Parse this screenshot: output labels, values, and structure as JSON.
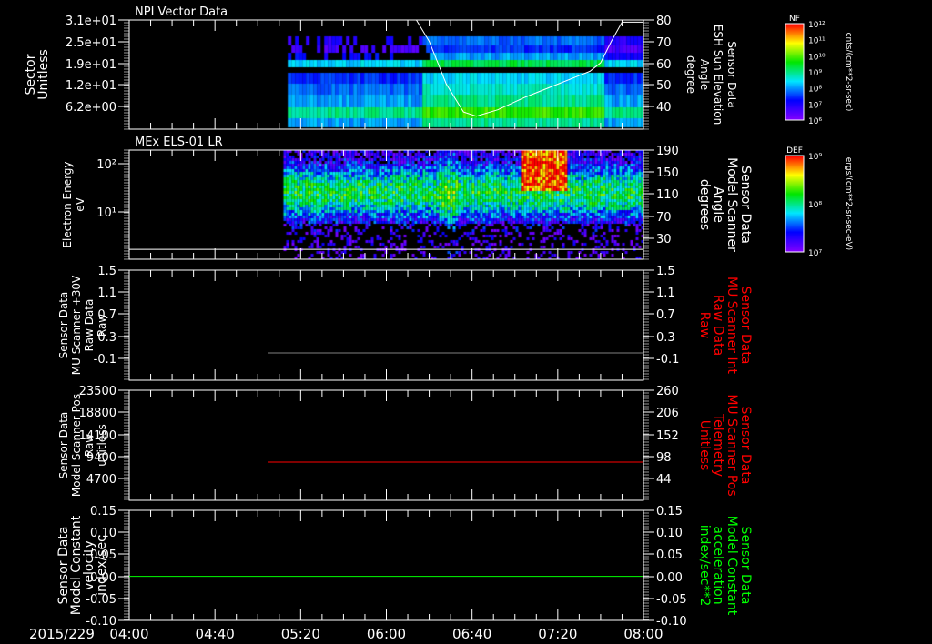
{
  "chart_data": {
    "type": "heatmap",
    "time_axis": {
      "date_label": "2015/229",
      "ticks": [
        "04:00",
        "04:40",
        "05:20",
        "06:00",
        "06:40",
        "07:20",
        "08:00"
      ],
      "range": [
        "04:00",
        "08:00"
      ]
    },
    "panels": [
      {
        "title": "NPI Vector Data",
        "left_label": [
          "Sector",
          "Unitless"
        ],
        "left_ticks": [
          "3.1e+01",
          "2.5e+01",
          "1.9e+01",
          "1.2e+01",
          "6.2e+00"
        ],
        "right_label": [
          "Sensor Data",
          "ESH Sun Elevation",
          "Angle",
          "degree"
        ],
        "right_label_color": "#ffffff",
        "right_ticks": [
          "80",
          "70",
          "60",
          "50",
          "40"
        ],
        "right_range": [
          29,
          80
        ],
        "spectrogram_start": "05:14",
        "line": {
          "color": "#ffffff",
          "x": [
            "06:14",
            "06:20",
            "06:28",
            "06:36",
            "06:42",
            "06:52",
            "07:05",
            "07:20",
            "07:35",
            "07:40",
            "07:45",
            "07:50",
            "08:00"
          ],
          "y": [
            80,
            70,
            50,
            37,
            35,
            38,
            44,
            50,
            56,
            60,
            70,
            79,
            79
          ]
        },
        "colorbar": {
          "label": "NF",
          "ticks": [
            "10¹²",
            "10¹¹",
            "10¹⁰",
            "10⁹",
            "10⁸",
            "10⁷",
            "10⁶"
          ],
          "units": "cnts/(cm**2-sr-sec)"
        }
      },
      {
        "title": "MEx ELS-01 LR",
        "left_label": [
          "Electron Energy",
          "eV"
        ],
        "left_ticks": [
          "10²",
          "10¹"
        ],
        "right_label": [
          "Sensor Data",
          "Model Scanner",
          "Angle",
          "degrees"
        ],
        "right_label_color": "#ffffff",
        "right_ticks": [
          "190",
          "150",
          "110",
          "70",
          "30"
        ],
        "spectrogram_start": "05:12",
        "line": {
          "color": "#ffffff",
          "x": [
            "04:00",
            "08:00"
          ],
          "y": [
            10,
            10
          ]
        },
        "colorbar": {
          "label": "DEF",
          "ticks": [
            "10⁹",
            "10⁸",
            "10⁷"
          ],
          "units": "ergs/(cm**2-sr-sec-eV)"
        }
      },
      {
        "left_label": [
          "Sensor Data",
          "MU Scanner +30V",
          "Raw Data",
          "Raw"
        ],
        "left_ticks": [
          "1.5",
          "1.1",
          "0.7",
          "0.3",
          "-0.1"
        ],
        "right_label": [
          "Sensor Data",
          "MU Scanner Int",
          "Raw Data",
          "Raw"
        ],
        "right_label_color": "#ff0000",
        "right_ticks": [
          "1.5",
          "1.1",
          "0.7",
          "0.3",
          "-0.1"
        ],
        "line": {
          "color": "#808080",
          "x": [
            "05:05",
            "08:00"
          ],
          "y": [
            0.0,
            0.0
          ]
        }
      },
      {
        "left_label": [
          "Sensor Data",
          "Model Scanner Pos",
          "Raw",
          "unitless"
        ],
        "left_ticks": [
          "23500",
          "18800",
          "14100",
          "9400",
          "4700"
        ],
        "right_label": [
          "Sensor Data",
          "MU Scanner Pos",
          "Telemetry",
          "Unitless"
        ],
        "right_label_color": "#ff0000",
        "right_ticks": [
          "260",
          "206",
          "152",
          "98",
          "44"
        ],
        "line": {
          "color": "#ff0000",
          "x": [
            "05:05",
            "08:00"
          ],
          "y": [
            8200,
            8200
          ]
        }
      },
      {
        "left_label": [
          "Sensor Data",
          "Model Constant",
          "velocity",
          "index/sec"
        ],
        "left_ticks": [
          "0.15",
          "0.10",
          "0.05",
          "0.00",
          "-0.05",
          "-0.10"
        ],
        "right_label": [
          "Sensor Data",
          "Model Constant",
          "acceleration",
          "index/sec**2"
        ],
        "right_label_color": "#00ff00",
        "right_ticks": [
          "0.15",
          "0.10",
          "0.05",
          "0.00",
          "-0.05",
          "-0.10"
        ],
        "line": {
          "color": "#00ff00",
          "x": [
            "04:00",
            "08:00"
          ],
          "y": [
            0,
            0
          ]
        }
      }
    ]
  }
}
